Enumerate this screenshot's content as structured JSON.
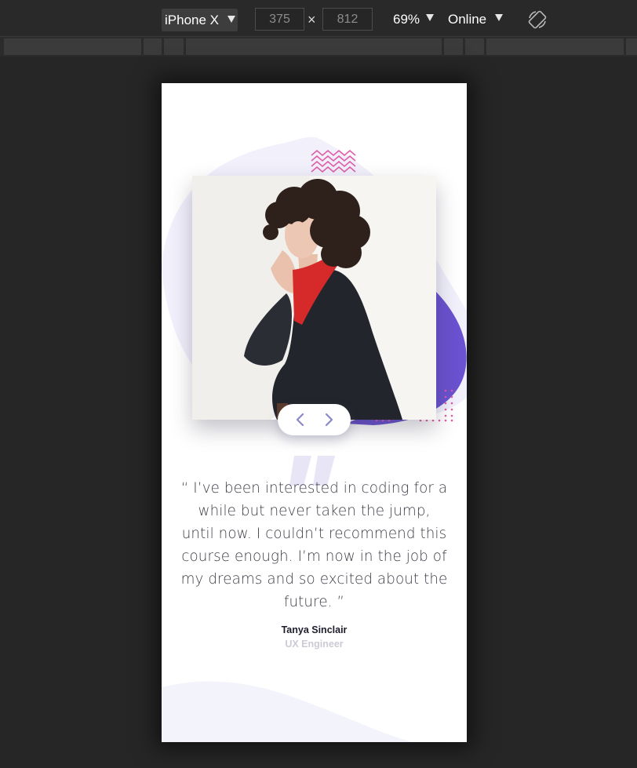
{
  "devtools": {
    "device": "iPhone X",
    "width": "375",
    "times": "×",
    "height": "812",
    "zoom": "69%",
    "network": "Online"
  },
  "testimonial": {
    "quote": "“ I’ve been interested in coding for a while but never taken the jump, until now. I couldn’t recommend this course enough. I’m now in the job of my dreams and so excited about the future. ”",
    "author": "Tanya Sinclair",
    "role": "UX Engineer"
  },
  "colors": {
    "page_bg": "#262626",
    "accent_purple": "#6a52d0",
    "accent_pink": "#e05aa8",
    "blob_light": "#f1f0fb",
    "controls_arrow": "#8a88c9"
  }
}
